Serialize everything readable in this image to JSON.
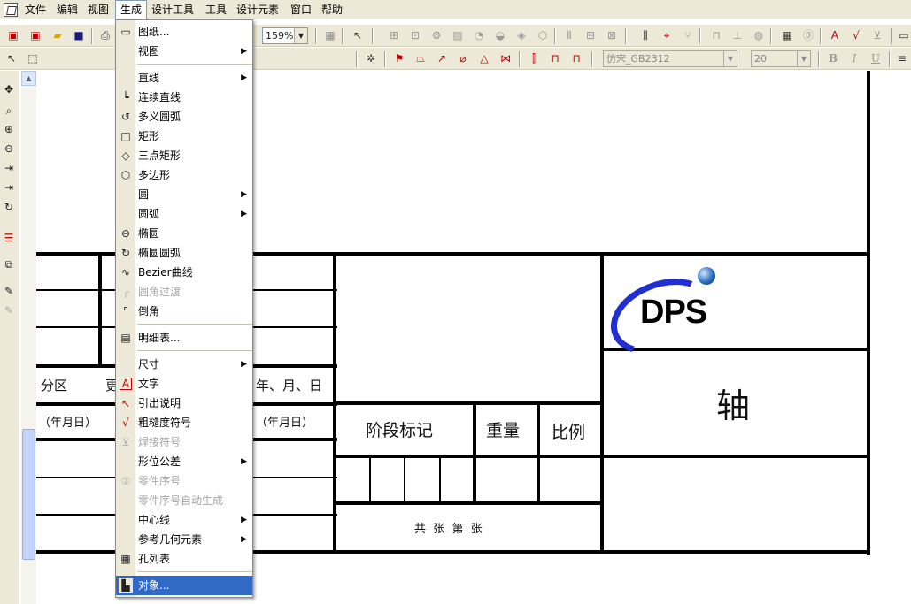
{
  "menubar": {
    "items": [
      "文件",
      "编辑",
      "视图",
      "生成",
      "设计工具",
      "工具",
      "设计元素",
      "窗口",
      "帮助"
    ],
    "active_index": 3
  },
  "toolbar1": {
    "zoom_value": "159%",
    "icons": [
      "new-file-icon",
      "new-drawing-icon",
      "open-folder-icon",
      "save-icon",
      "print-icon",
      "table-grid-icon",
      "help-pointer-icon"
    ]
  },
  "toolbar2": {
    "font_value": "仿宋_GB2312",
    "size_value": "20",
    "bold_label": "B",
    "italic_label": "I",
    "underline_label": "U"
  },
  "generate_menu": {
    "items": [
      {
        "label": "图纸...",
        "icon": "drawing-sheet-icon",
        "enabled": true,
        "submenu": false
      },
      {
        "label": "视图",
        "icon": "",
        "enabled": true,
        "submenu": true
      },
      {
        "label": "直线",
        "icon": "",
        "enabled": true,
        "submenu": true
      },
      {
        "label": "连续直线",
        "icon": "polyline-icon",
        "enabled": true,
        "submenu": false
      },
      {
        "label": "多义圆弧",
        "icon": "poly-arc-icon",
        "enabled": true,
        "submenu": false
      },
      {
        "label": "矩形",
        "icon": "rectangle-icon",
        "enabled": true,
        "submenu": false
      },
      {
        "label": "三点矩形",
        "icon": "diamond-icon",
        "enabled": true,
        "submenu": false
      },
      {
        "label": "多边形",
        "icon": "polygon-icon",
        "enabled": true,
        "submenu": false
      },
      {
        "label": "圆",
        "icon": "",
        "enabled": true,
        "submenu": true
      },
      {
        "label": "圆弧",
        "icon": "",
        "enabled": true,
        "submenu": true
      },
      {
        "label": "椭圆",
        "icon": "ellipse-icon",
        "enabled": true,
        "submenu": false
      },
      {
        "label": "椭圆圆弧",
        "icon": "ellipse-arc-icon",
        "enabled": true,
        "submenu": false
      },
      {
        "label": "Bezier曲线",
        "icon": "bezier-icon",
        "enabled": true,
        "submenu": false
      },
      {
        "label": "圆角过渡",
        "icon": "fillet-icon",
        "enabled": false,
        "submenu": false
      },
      {
        "label": "倒角",
        "icon": "chamfer-icon",
        "enabled": true,
        "submenu": false
      },
      {
        "label": "明细表...",
        "icon": "bom-table-icon",
        "enabled": true,
        "submenu": false
      },
      {
        "label": "尺寸",
        "icon": "",
        "enabled": true,
        "submenu": true
      },
      {
        "label": "文字",
        "icon": "text-a-icon",
        "enabled": true,
        "submenu": false
      },
      {
        "label": "引出说明",
        "icon": "leader-note-icon",
        "enabled": true,
        "submenu": false
      },
      {
        "label": "粗糙度符号",
        "icon": "roughness-icon",
        "enabled": true,
        "submenu": false
      },
      {
        "label": "焊接符号",
        "icon": "weld-icon",
        "enabled": false,
        "submenu": false
      },
      {
        "label": "形位公差",
        "icon": "",
        "enabled": true,
        "submenu": true
      },
      {
        "label": "零件序号",
        "icon": "part-number-icon",
        "enabled": false,
        "submenu": false
      },
      {
        "label": "零件序号自动生成",
        "icon": "",
        "enabled": false,
        "submenu": false
      },
      {
        "label": "中心线",
        "icon": "",
        "enabled": true,
        "submenu": true
      },
      {
        "label": "参考几何元素",
        "icon": "",
        "enabled": true,
        "submenu": true
      },
      {
        "label": "孔列表",
        "icon": "hole-table-icon",
        "enabled": true,
        "submenu": false
      },
      {
        "label": "对象...",
        "icon": "object-icon",
        "enabled": true,
        "submenu": false
      }
    ],
    "selected_label": "对象..."
  },
  "title_block": {
    "zone_label": "分区",
    "partial_label": "更",
    "date_label": "年、月、日",
    "date_paren_left": "（年月日）",
    "date_paren_right": "（年月日）",
    "stage_label": "阶段标记",
    "weight_label": "重量",
    "scale_label": "比例",
    "sheet_label": "共  张  第  张",
    "part_name": "轴",
    "logo_text": "DPS"
  }
}
